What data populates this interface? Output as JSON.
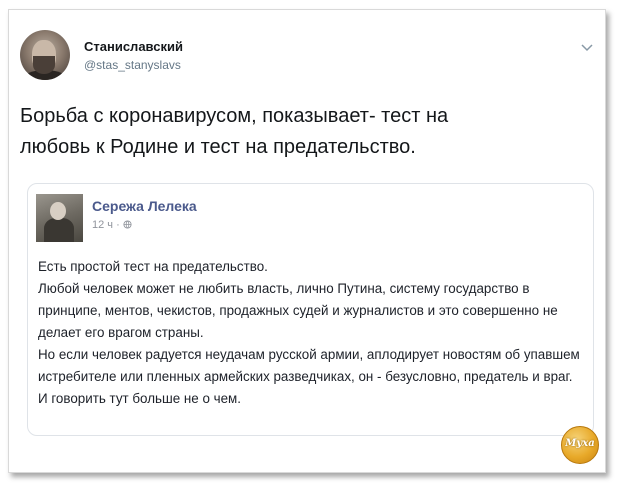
{
  "tweet": {
    "author": {
      "display_name": "Станиславский",
      "handle": "@stas_stanyslavs",
      "avatar_icon": "user-avatar"
    },
    "menu_icon": "chevron-down-icon",
    "text_line1": "Борьба с коронавирусом, показывает- тест на",
    "text_line2": "любовь к Родине и тест на предательство."
  },
  "quote": {
    "author": {
      "name": "Сережа Лелека",
      "avatar_icon": "user-avatar"
    },
    "meta": "12 ч · ",
    "privacy_icon": "globe-icon",
    "paragraphs": [
      "Есть простой тест на предательство.",
      "Любой человек может не любить власть, лично Путина, систему государство в принципе, ментов, чекистов, продажных судей и журналистов и это совершенно не делает его врагом страны.",
      "Но если человек радуется неудачам русской армии, аплодирует новостям об упавшем истребителе или пленных армейских разведчиках, он - безусловно, предатель и враг. И говорить тут больше не о чем."
    ]
  },
  "watermark": {
    "text": "Муха"
  },
  "colors": {
    "name_link": "#4b5a8c",
    "handle": "#657786",
    "meta": "#90949c"
  }
}
